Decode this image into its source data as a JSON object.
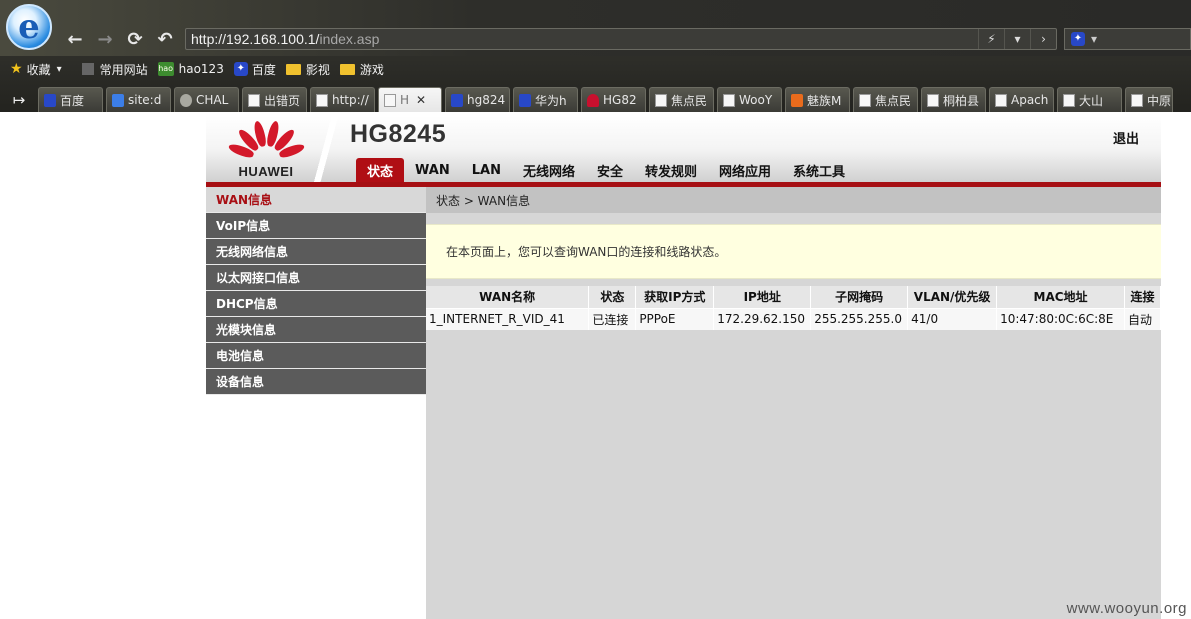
{
  "browser": {
    "address_host": "http://192.168.100.1/",
    "address_path": "index.asp",
    "bookmarks": {
      "favorites": "收藏",
      "items": [
        "常用网站",
        "hao123",
        "百度",
        "影视",
        "游戏"
      ]
    },
    "tabs": [
      "百度",
      "site:d",
      "CHAL",
      "出错页",
      "http://",
      "H",
      "hg824",
      "华为h",
      "HG82",
      "焦点民",
      "WooY",
      "魅族M",
      "焦点民",
      "桐柏县",
      "Apach",
      "大山",
      "中原"
    ]
  },
  "router": {
    "brand": "HUAWEI",
    "model": "HG8245",
    "logout": "退出",
    "nav": [
      "状态",
      "WAN",
      "LAN",
      "无线网络",
      "安全",
      "转发规则",
      "网络应用",
      "系统工具"
    ],
    "sidebar": [
      "WAN信息",
      "VoIP信息",
      "无线网络信息",
      "以太网接口信息",
      "DHCP信息",
      "光模块信息",
      "电池信息",
      "设备信息"
    ],
    "breadcrumb": "状态 > WAN信息",
    "info_text": "在本页面上，您可以查询WAN口的连接和线路状态。",
    "table": {
      "headers": [
        "WAN名称",
        "状态",
        "获取IP方式",
        "IP地址",
        "子网掩码",
        "VLAN/优先级",
        "MAC地址",
        "连接"
      ],
      "rows": [
        [
          "1_INTERNET_R_VID_41",
          "已连接",
          "PPPoE",
          "172.29.62.150",
          "255.255.255.0",
          "41/0",
          "10:47:80:0C:6C:8E",
          "自动"
        ]
      ]
    }
  },
  "watermark": "www.wooyun.org",
  "colors": {
    "accent_red": "#a60f13",
    "sidebar_bg": "#5b5b5b",
    "info_bg": "#ffffe0"
  }
}
